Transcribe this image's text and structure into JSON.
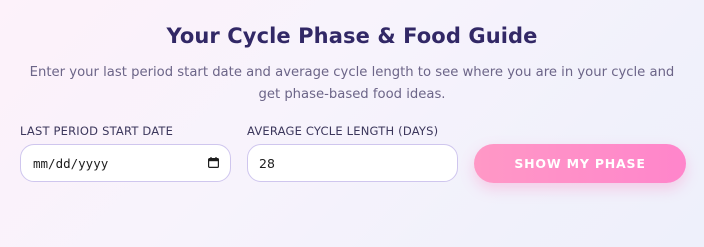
{
  "header": {
    "title": "Your Cycle Phase & Food Guide",
    "subtitle": "Enter your last period start date and average cycle length to see where you are in your cycle and get phase-based food ideas."
  },
  "form": {
    "date_label": "LAST PERIOD START DATE",
    "date_value": "mm/dd/yyyy",
    "date_icon": "calendar-icon",
    "cycle_label": "AVERAGE CYCLE LENGTH (DAYS)",
    "cycle_value": "28",
    "submit_label": "SHOW MY PHASE"
  },
  "colors": {
    "title": "#322866",
    "subtitle": "#6c6588",
    "input_border": "#cfc6ee",
    "button_start": "#ff98c6",
    "button_end": "#ff85cb"
  }
}
